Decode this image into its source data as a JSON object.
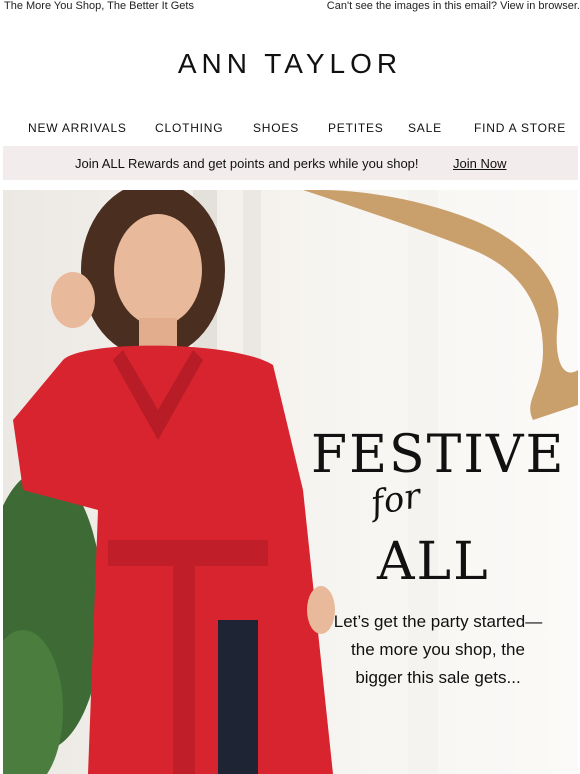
{
  "preheader": {
    "left": "The More You Shop, The Better It Gets",
    "right": "Can't see the images in this email? View in browser."
  },
  "brand": {
    "logo": "ANN TAYLOR"
  },
  "nav": {
    "items": [
      {
        "label": "NEW ARRIVALS"
      },
      {
        "label": "CLOTHING"
      },
      {
        "label": "SHOES"
      },
      {
        "label": "PETITES"
      },
      {
        "label": "SALE"
      },
      {
        "label": "FIND A STORE"
      }
    ]
  },
  "rewards": {
    "message": "Join ALL Rewards and get points and perks while you shop!",
    "cta": "Join Now",
    "background": "#f3ecec"
  },
  "hero": {
    "headline_top": "FESTIVE",
    "headline_script": "for",
    "headline_bottom": "ALL",
    "body": "Let’s get the party started—the more you shop, the bigger this sale gets...",
    "colors": {
      "sweater": "#d8242f",
      "ribbon": "#c9a06c",
      "greenery": "#3e6b35"
    }
  }
}
